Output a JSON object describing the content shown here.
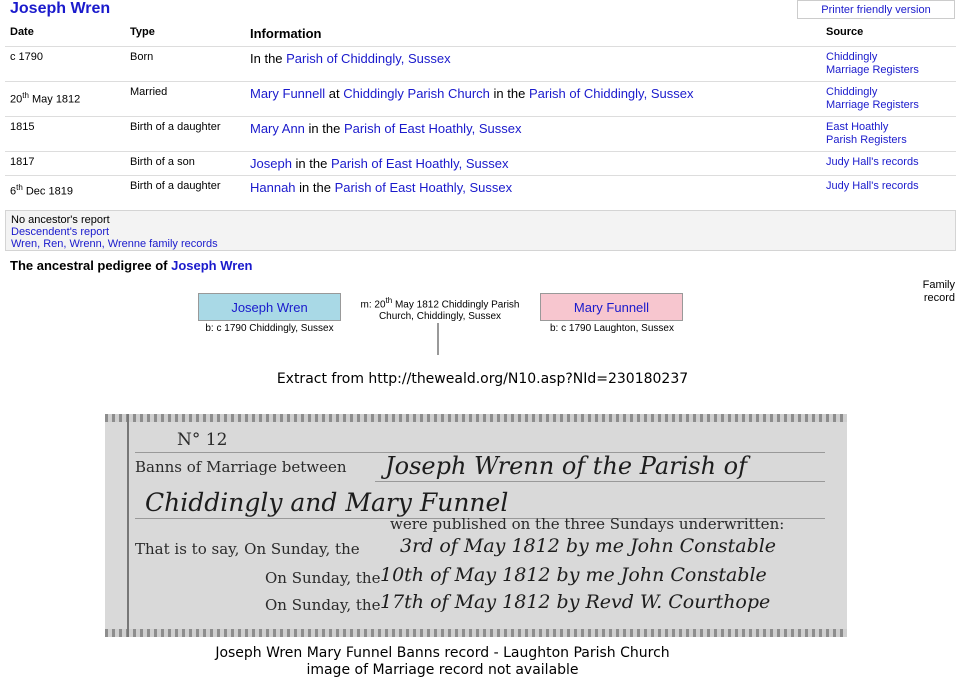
{
  "page": {
    "title": "Joseph Wren",
    "printer_link": "Printer friendly version"
  },
  "table": {
    "headers": {
      "date": "Date",
      "type": "Type",
      "information": "Information",
      "source": "Source"
    },
    "rows": [
      {
        "date": "c 1790",
        "type": "Born",
        "info": [
          {
            "t": "In the ",
            "link": false
          },
          {
            "t": "Parish of Chiddingly, Sussex",
            "link": true
          }
        ],
        "source": [
          "Chiddingly",
          "Marriage Registers"
        ]
      },
      {
        "date_day": "20",
        "date_suffix": "th",
        "date_rest": " May 1812",
        "type": "Married",
        "info": [
          {
            "t": "Mary Funnell",
            "link": true
          },
          {
            "t": " at ",
            "link": false
          },
          {
            "t": "Chiddingly Parish Church",
            "link": true
          },
          {
            "t": " in the ",
            "link": false
          },
          {
            "t": "Parish of Chiddingly, Sussex",
            "link": true
          }
        ],
        "source": [
          "Chiddingly",
          "Marriage Registers"
        ]
      },
      {
        "date": "1815",
        "type": "Birth of a daughter",
        "info": [
          {
            "t": "Mary Ann",
            "link": true
          },
          {
            "t": " in the ",
            "link": false
          },
          {
            "t": "Parish of East Hoathly, Sussex",
            "link": true
          }
        ],
        "source": [
          "East Hoathly",
          "Parish Registers"
        ]
      },
      {
        "date": "1817",
        "type": "Birth of a son",
        "info": [
          {
            "t": "Joseph",
            "link": true
          },
          {
            "t": " in the ",
            "link": false
          },
          {
            "t": "Parish of East Hoathly, Sussex",
            "link": true
          }
        ],
        "source": [
          "Judy Hall's records"
        ]
      },
      {
        "date_day": "6",
        "date_suffix": "th",
        "date_rest": " Dec 1819",
        "type": "Birth of a daughter",
        "info": [
          {
            "t": "Hannah",
            "link": true
          },
          {
            "t": " in the ",
            "link": false
          },
          {
            "t": "Parish of East Hoathly, Sussex",
            "link": true
          }
        ],
        "source": [
          "Judy Hall's records"
        ]
      }
    ]
  },
  "reports": {
    "ancestors": "No ancestor's report",
    "descendents": "Descendent's report",
    "family": "Wren, Ren, Wrenn, Wrenne family records"
  },
  "pedigree": {
    "heading_prefix": "The ancestral pedigree of ",
    "heading_name": "Joseph Wren",
    "family_record": "Family record",
    "husband": {
      "name": "Joseph Wren",
      "info": "b: c 1790 Chiddingly, Sussex"
    },
    "wife": {
      "name": "Mary Funnell",
      "info": "b: c 1790 Laughton, Sussex"
    },
    "marriage_prefix": "m: ",
    "marriage_day": "20",
    "marriage_suffix": "th",
    "marriage_rest": " May 1812 Chiddingly Parish Church, Chiddingly, Sussex"
  },
  "caption_extract": "Extract from http://theweald.org/N10.asp?NId=230180237",
  "scan": {
    "number": "N° 12",
    "banns_print": "Banns of Marriage between",
    "banns_hand": "Joseph Wrenn of the Parish of",
    "line2_hand": "Chiddingly and Mary Funnel",
    "published": "were published on the three Sundays underwritten:",
    "line_a_print": "That is to say, On Sunday, the",
    "line_a_hand": "3rd of May 1812 by me John Constable",
    "line_b_print": "On Sunday, the",
    "line_b_hand": "10th of May 1812 by me John Constable",
    "line_c_print": "On Sunday, the",
    "line_c_hand": "17th of May 1812 by Revd W. Courthope"
  },
  "caption_banns": [
    "Joseph Wren Mary Funnel Banns record - Laughton Parish Church",
    "image of Marriage record not available"
  ]
}
